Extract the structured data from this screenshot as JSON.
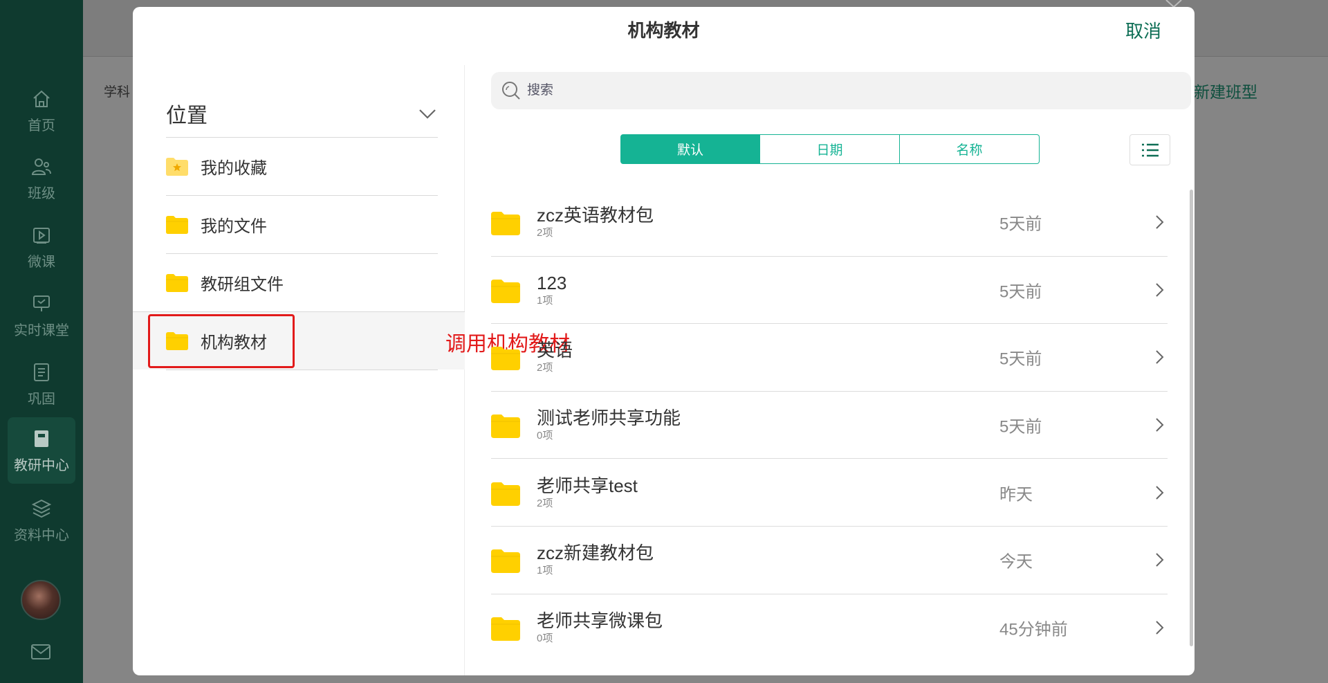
{
  "sidebar": {
    "items": [
      {
        "label": "首页",
        "icon": "home-icon"
      },
      {
        "label": "班级",
        "icon": "users-icon"
      },
      {
        "label": "微课",
        "icon": "video-icon"
      },
      {
        "label": "实时课堂",
        "icon": "presentation-icon"
      },
      {
        "label": "巩固",
        "icon": "list-icon"
      },
      {
        "label": "教研中心",
        "icon": "book-icon",
        "active": true
      },
      {
        "label": "资料中心",
        "icon": "layers-icon"
      }
    ]
  },
  "background": {
    "left_label": "学科",
    "right_label": "新建班型"
  },
  "modal": {
    "title": "机构教材",
    "cancel_label": "取消",
    "location": {
      "header": "位置",
      "items": [
        {
          "label": "我的收藏",
          "icon": "star-folder-icon"
        },
        {
          "label": "我的文件",
          "icon": "folder-icon"
        },
        {
          "label": "教研组文件",
          "icon": "folder-icon"
        },
        {
          "label": "机构教材",
          "icon": "folder-icon",
          "active": true
        }
      ]
    },
    "annotation": "调用机构教材",
    "search": {
      "placeholder": "搜索"
    },
    "sort": {
      "options": [
        "默认",
        "日期",
        "名称"
      ],
      "selected": "默认"
    },
    "files": [
      {
        "name": "zcz英语教材包",
        "count": "2项",
        "date": "5天前"
      },
      {
        "name": "123",
        "count": "1项",
        "date": "5天前"
      },
      {
        "name": "英语",
        "count": "2项",
        "date": "5天前"
      },
      {
        "name": "测试老师共享功能",
        "count": "0项",
        "date": "5天前"
      },
      {
        "name": "老师共享test",
        "count": "2项",
        "date": "昨天"
      },
      {
        "name": "zcz新建教材包",
        "count": "1项",
        "date": "今天"
      },
      {
        "name": "老师共享微课包",
        "count": "0项",
        "date": "45分钟前"
      }
    ]
  },
  "colors": {
    "accent": "#15b394",
    "sidebar_bg": "#0f3a2f",
    "folder": "#ffd000",
    "annotation": "#e21a1a"
  }
}
